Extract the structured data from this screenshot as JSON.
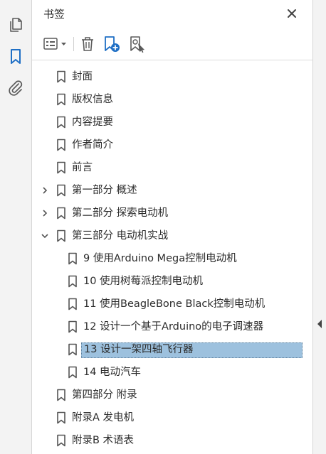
{
  "panel": {
    "title": "书签"
  },
  "rail": {
    "icons": [
      "pages-icon",
      "bookmark-icon",
      "attachment-icon"
    ],
    "active": "bookmark-icon"
  },
  "toolbar": {
    "icons": [
      "options-menu-icon",
      "delete-icon",
      "new-bookmark-icon",
      "find-bookmark-icon"
    ]
  },
  "bookmarks": [
    {
      "label": "封面",
      "level": 0,
      "expand": "none"
    },
    {
      "label": "版权信息",
      "level": 0,
      "expand": "none"
    },
    {
      "label": "内容提要",
      "level": 0,
      "expand": "none"
    },
    {
      "label": "作者简介",
      "level": 0,
      "expand": "none"
    },
    {
      "label": "前言",
      "level": 0,
      "expand": "none"
    },
    {
      "label": "第一部分 概述",
      "level": 0,
      "expand": "collapsed"
    },
    {
      "label": "第二部分 探索电动机",
      "level": 0,
      "expand": "collapsed"
    },
    {
      "label": "第三部分 电动机实战",
      "level": 0,
      "expand": "expanded"
    },
    {
      "label": "9 使用Arduino Mega控制电动机",
      "level": 1,
      "expand": "none"
    },
    {
      "label": "10 使用树莓派控制电动机",
      "level": 1,
      "expand": "none"
    },
    {
      "label": "11 使用BeagleBone Black控制电动机",
      "level": 1,
      "expand": "none"
    },
    {
      "label": "12 设计一个基于Arduino的电子调速器",
      "level": 1,
      "expand": "none"
    },
    {
      "label": "13 设计一架四轴飞行器",
      "level": 1,
      "expand": "none",
      "selected": true
    },
    {
      "label": "14 电动汽车",
      "level": 1,
      "expand": "none"
    },
    {
      "label": "第四部分 附录",
      "level": 0,
      "expand": "none"
    },
    {
      "label": "附录A 发电机",
      "level": 0,
      "expand": "none"
    },
    {
      "label": "附录B 术语表",
      "level": 0,
      "expand": "none"
    }
  ],
  "colors": {
    "accent": "#1f6fc5",
    "selection": "#9dc1de",
    "icon": "#5a5a5a"
  }
}
